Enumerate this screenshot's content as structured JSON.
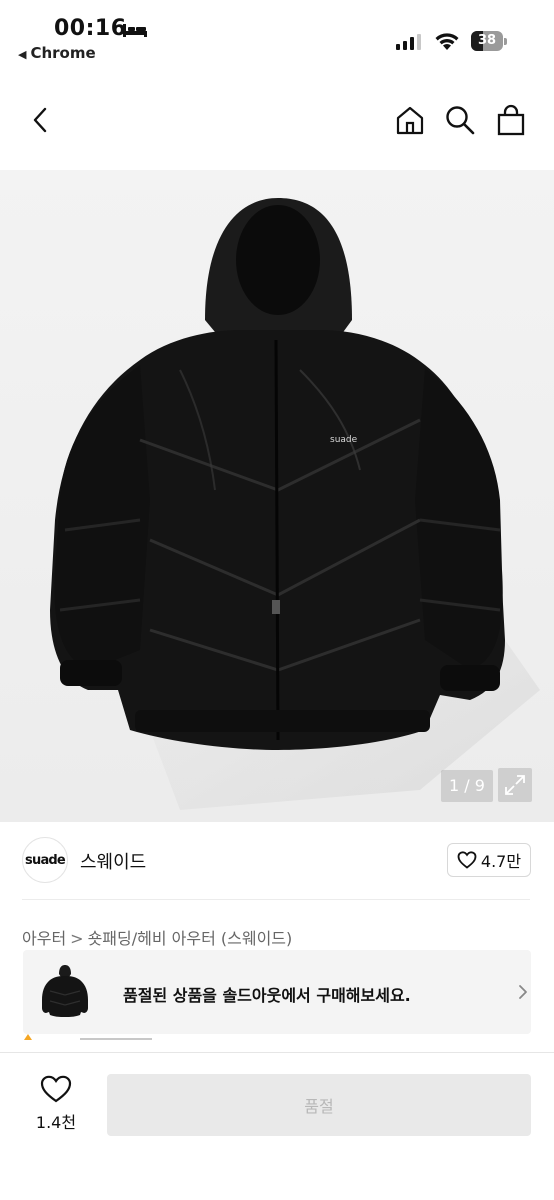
{
  "status_bar": {
    "time": "00:16",
    "back_app": "Chrome",
    "battery_level": 38,
    "battery_label": "38"
  },
  "nav": {
    "back_icon": "chevron-left-icon",
    "home_icon": "home-icon",
    "search_icon": "search-icon",
    "cart_icon": "shopping-bag-icon"
  },
  "gallery": {
    "image_alt": "black hooded puffer jacket",
    "jacket_logo_text": "suade",
    "current": 1,
    "total": 9,
    "counter_text": "1 / 9",
    "expand_icon": "expand-icon"
  },
  "brand": {
    "logo_text": "suade",
    "name": "스웨이드",
    "like_count": "4.7만"
  },
  "breadcrumb": {
    "items": [
      "아우터",
      "숏패딩/헤비 아우터 (스웨이드)"
    ],
    "separator": ">"
  },
  "soldout_banner": {
    "text": "품절된 상품을 솔드아웃에서 구매해보세요.",
    "chevron_icon": "chevron-right-icon"
  },
  "bottom_bar": {
    "wish_count": "1.4천",
    "buy_label": "품절"
  },
  "colors": {
    "accent": "#111111",
    "disabled_button": "#e9e9e9",
    "disabled_text": "#b8b8b8",
    "banner_bg": "#f4f4f4",
    "rating_star": "#f5a623"
  }
}
